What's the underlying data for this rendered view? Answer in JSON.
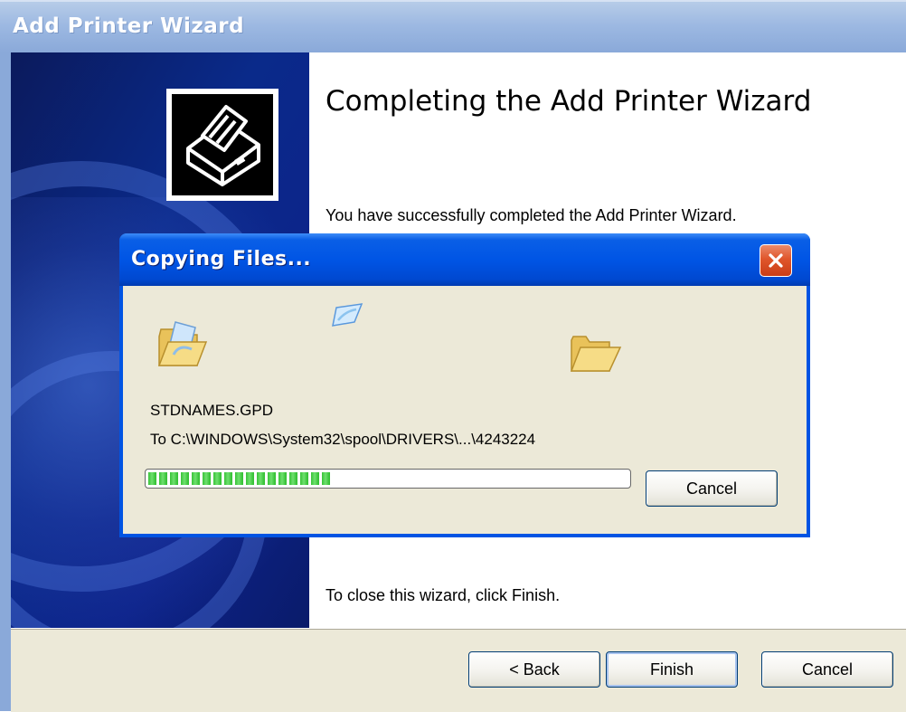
{
  "wizard": {
    "title": "Add Printer Wizard",
    "heading": "Completing the Add Printer Wizard",
    "body_text": "You have successfully completed the Add Printer Wizard.",
    "close_hint": "To close this wizard, click Finish.",
    "buttons": {
      "back": "< Back",
      "finish": "Finish",
      "cancel": "Cancel"
    }
  },
  "copy_dialog": {
    "title": "Copying Files...",
    "filename": "STDNAMES.GPD",
    "destination": "To C:\\WINDOWS\\System32\\spool\\DRIVERS\\...\\4243224",
    "progress": 0.38,
    "cancel_label": "Cancel"
  },
  "colors": {
    "title_bar_active": "#0055e5",
    "title_bar_inactive": "#9db9e2",
    "dialog_face": "#ece9d8",
    "progress_green": "#37c237",
    "close_red": "#e0562b"
  },
  "icons": {
    "wizard_logo": "printer-icon",
    "source": "folder-open-icon",
    "flying": "document-icon",
    "target": "folder-icon",
    "close": "close-icon"
  }
}
